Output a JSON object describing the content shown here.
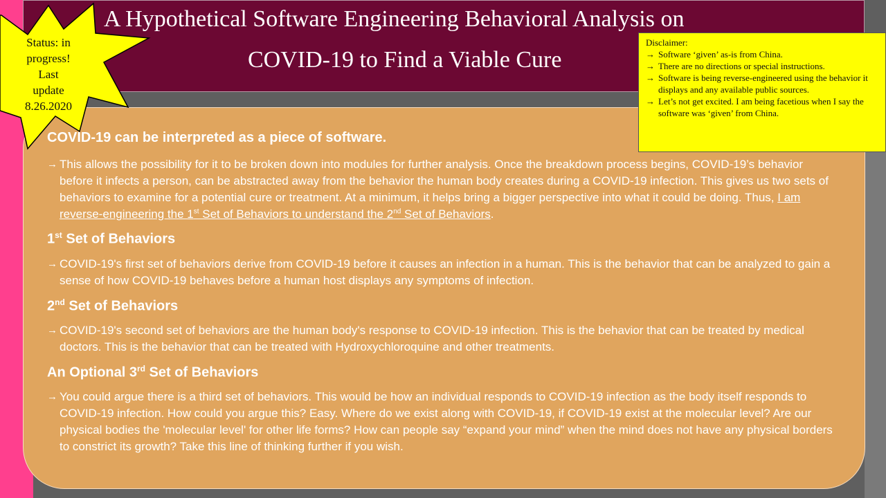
{
  "title": {
    "line1": "A Hypothetical Software Engineering Behavioral Analysis on",
    "line2": "COVID-19 to Find a Viable Cure"
  },
  "status_badge": {
    "lines": [
      "Status: in",
      "progress!",
      "Last",
      "update",
      "8.26.2020"
    ]
  },
  "disclaimer": {
    "heading": "Disclaimer:",
    "arrow": "→",
    "items": [
      "Software ‘given’ as-is from China.",
      "There are no directions or special instructions.",
      "Software is being reverse-engineered using the behavior it displays and any available public sources.",
      "Let’s not get excited. I am being facetious when I say the software was ‘given’ from China."
    ]
  },
  "content": {
    "arrow": "→",
    "heading_intro": "COVID-19 can be interpreted as a piece of software.",
    "para_intro": {
      "text": "This allows the possibility for it to be broken down into modules for further analysis. Once the breakdown process begins, COVID-19’s behavior before it infects a person, can be abstracted away from the behavior the human body creates during a COVID-19 infection. This gives us two sets of behaviors to examine for a potential cure or treatment. At a minimum, it helps bring a bigger perspective into what it could be doing. Thus, ",
      "link_part1": "I am reverse-engineering the 1",
      "link_sup1": "st",
      "link_part2": " Set of Behaviors to understand the 2",
      "link_sup2": "nd",
      "link_part3": " Set of Behaviors",
      "end": "."
    },
    "heading_first": {
      "num": "1",
      "sup": "st",
      "rest": " Set of Behaviors"
    },
    "para_first": "COVID-19's first set of behaviors derive from COVID-19 before it causes an infection in a human. This is the behavior that can be analyzed to gain a sense of how COVID-19 behaves before a human host displays any symptoms of infection.",
    "heading_second": {
      "num": "2",
      "sup": "nd",
      "rest": " Set of Behaviors"
    },
    "para_second": "COVID-19's second set of behaviors are the human body's response to COVID-19 infection. This is the behavior that can be treated by medical doctors. This is the behavior that can be treated with Hydroxychloroquine and other treatments.",
    "heading_third": {
      "prefix": "An Optional 3",
      "sup": "rd",
      "rest": " Set of Behaviors"
    },
    "para_third": "You could argue there is a third set of behaviors. This would be how an individual responds to COVID-19 infection as the body itself responds to COVID-19 infection. How could you argue this? Easy. Where do we exist along with COVID-19, if COVID-19 exist at the molecular level? Are our physical bodies the 'molecular level' for other life forms? How can people say “expand your mind” when the mind does not have any physical borders to constrict its growth? Take this line of thinking further if you wish."
  },
  "colors": {
    "title_bg": "#6c0833",
    "panel_bg": "#e0a55e",
    "star_fill": "#ffff00",
    "pink_strip": "#ff3f8e"
  }
}
